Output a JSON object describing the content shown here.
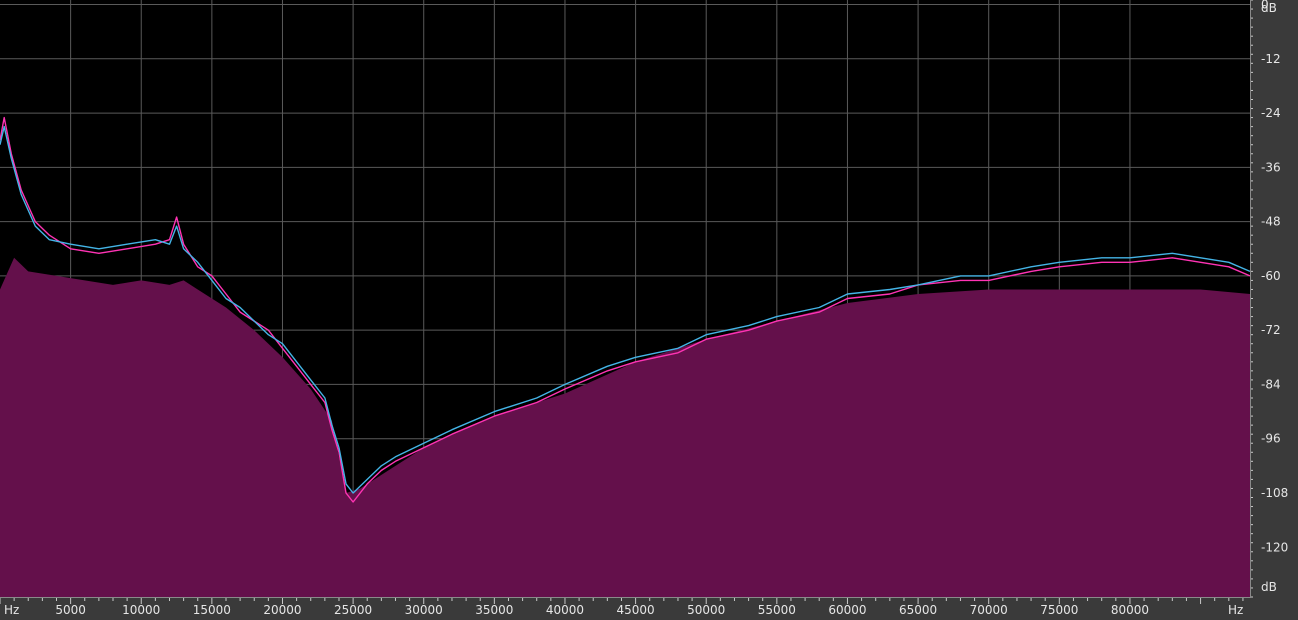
{
  "chart_data": {
    "type": "area",
    "title": "",
    "x_unit_label": "Hz",
    "y_unit_label": "dB",
    "xlim": [
      0,
      88500
    ],
    "ylim": [
      -131,
      1
    ],
    "x_ticks": [
      {
        "value": 5000,
        "label": "5000"
      },
      {
        "value": 10000,
        "label": "10000"
      },
      {
        "value": 15000,
        "label": "15000"
      },
      {
        "value": 20000,
        "label": "20000"
      },
      {
        "value": 25000,
        "label": "25000"
      },
      {
        "value": 30000,
        "label": "30000"
      },
      {
        "value": 35000,
        "label": "35000"
      },
      {
        "value": 40000,
        "label": "40000"
      },
      {
        "value": 45000,
        "label": "45000"
      },
      {
        "value": 50000,
        "label": "50000"
      },
      {
        "value": 55000,
        "label": "55000"
      },
      {
        "value": 60000,
        "label": "60000"
      },
      {
        "value": 65000,
        "label": "65000"
      },
      {
        "value": 70000,
        "label": "70000"
      },
      {
        "value": 75000,
        "label": "75000"
      },
      {
        "value": 80000,
        "label": "80000"
      }
    ],
    "y_ticks": [
      {
        "value": 0,
        "label": "0"
      },
      {
        "value": -12,
        "label": "-12"
      },
      {
        "value": -24,
        "label": "-24"
      },
      {
        "value": -36,
        "label": "-36"
      },
      {
        "value": -48,
        "label": "-48"
      },
      {
        "value": -60,
        "label": "-60"
      },
      {
        "value": -72,
        "label": "-72"
      },
      {
        "value": -84,
        "label": "-84"
      },
      {
        "value": -96,
        "label": "-96"
      },
      {
        "value": -108,
        "label": "-108"
      },
      {
        "value": -120,
        "label": "-120"
      }
    ],
    "grid": true,
    "series": [
      {
        "role": "fill",
        "color": "#64104b",
        "x": [
          0,
          1000,
          2000,
          4000,
          6000,
          8000,
          10000,
          12000,
          13000,
          14000,
          16000,
          18000,
          20000,
          22000,
          23500,
          24500,
          25500,
          27000,
          30000,
          35000,
          40000,
          45000,
          50000,
          55000,
          60000,
          65000,
          70000,
          75000,
          80000,
          85000,
          88500
        ],
        "y": [
          -63,
          -56,
          -59,
          -60,
          -61,
          -62,
          -61,
          -62,
          -61,
          -63,
          -67,
          -72,
          -78,
          -85,
          -92,
          -108,
          -107,
          -104,
          -98,
          -91,
          -86,
          -79,
          -74,
          -70,
          -66,
          -64,
          -63,
          -63,
          -63,
          -63,
          -64
        ]
      },
      {
        "role": "line",
        "color": "#ff33b4",
        "x": [
          0,
          300,
          800,
          1500,
          2500,
          3500,
          5000,
          7000,
          9000,
          11000,
          12000,
          12500,
          13000,
          14000,
          15000,
          16000,
          17000,
          18000,
          19000,
          20000,
          21000,
          22000,
          23000,
          23500,
          24000,
          24500,
          25000,
          26000,
          27000,
          28000,
          30000,
          32000,
          35000,
          38000,
          40000,
          43000,
          45000,
          48000,
          50000,
          53000,
          55000,
          58000,
          60000,
          63000,
          65000,
          68000,
          70000,
          73000,
          75000,
          78000,
          80000,
          83000,
          85000,
          87000,
          88500
        ],
        "y": [
          -30,
          -25,
          -33,
          -41,
          -48,
          -51,
          -54,
          -55,
          -54,
          -53,
          -52,
          -47,
          -53,
          -58,
          -60,
          -64,
          -68,
          -70,
          -72,
          -76,
          -80,
          -84,
          -88,
          -94,
          -99,
          -108,
          -110,
          -106,
          -103,
          -101,
          -98,
          -95,
          -91,
          -88,
          -85,
          -81,
          -79,
          -77,
          -74,
          -72,
          -70,
          -68,
          -65,
          -64,
          -62,
          -61,
          -61,
          -59,
          -58,
          -57,
          -57,
          -56,
          -57,
          -58,
          -60
        ]
      },
      {
        "role": "line",
        "color": "#44b4e6",
        "x": [
          0,
          300,
          800,
          1500,
          2500,
          3500,
          5000,
          7000,
          9000,
          11000,
          12000,
          12500,
          13000,
          14000,
          15000,
          16000,
          17000,
          18000,
          19000,
          20000,
          21000,
          22000,
          23000,
          23500,
          24000,
          24500,
          25000,
          26000,
          27000,
          28000,
          30000,
          32000,
          35000,
          38000,
          40000,
          43000,
          45000,
          48000,
          50000,
          53000,
          55000,
          58000,
          60000,
          63000,
          65000,
          68000,
          70000,
          73000,
          75000,
          78000,
          80000,
          83000,
          85000,
          87000,
          88500
        ],
        "y": [
          -31,
          -27,
          -34,
          -42,
          -49,
          -52,
          -53,
          -54,
          -53,
          -52,
          -53,
          -49,
          -54,
          -57,
          -61,
          -65,
          -67,
          -70,
          -73,
          -75,
          -79,
          -83,
          -87,
          -93,
          -98,
          -106,
          -108,
          -105,
          -102,
          -100,
          -97,
          -94,
          -90,
          -87,
          -84,
          -80,
          -78,
          -76,
          -73,
          -71,
          -69,
          -67,
          -64,
          -63,
          -62,
          -60,
          -60,
          -58,
          -57,
          -56,
          -56,
          -55,
          -56,
          -57,
          -59
        ]
      }
    ]
  }
}
